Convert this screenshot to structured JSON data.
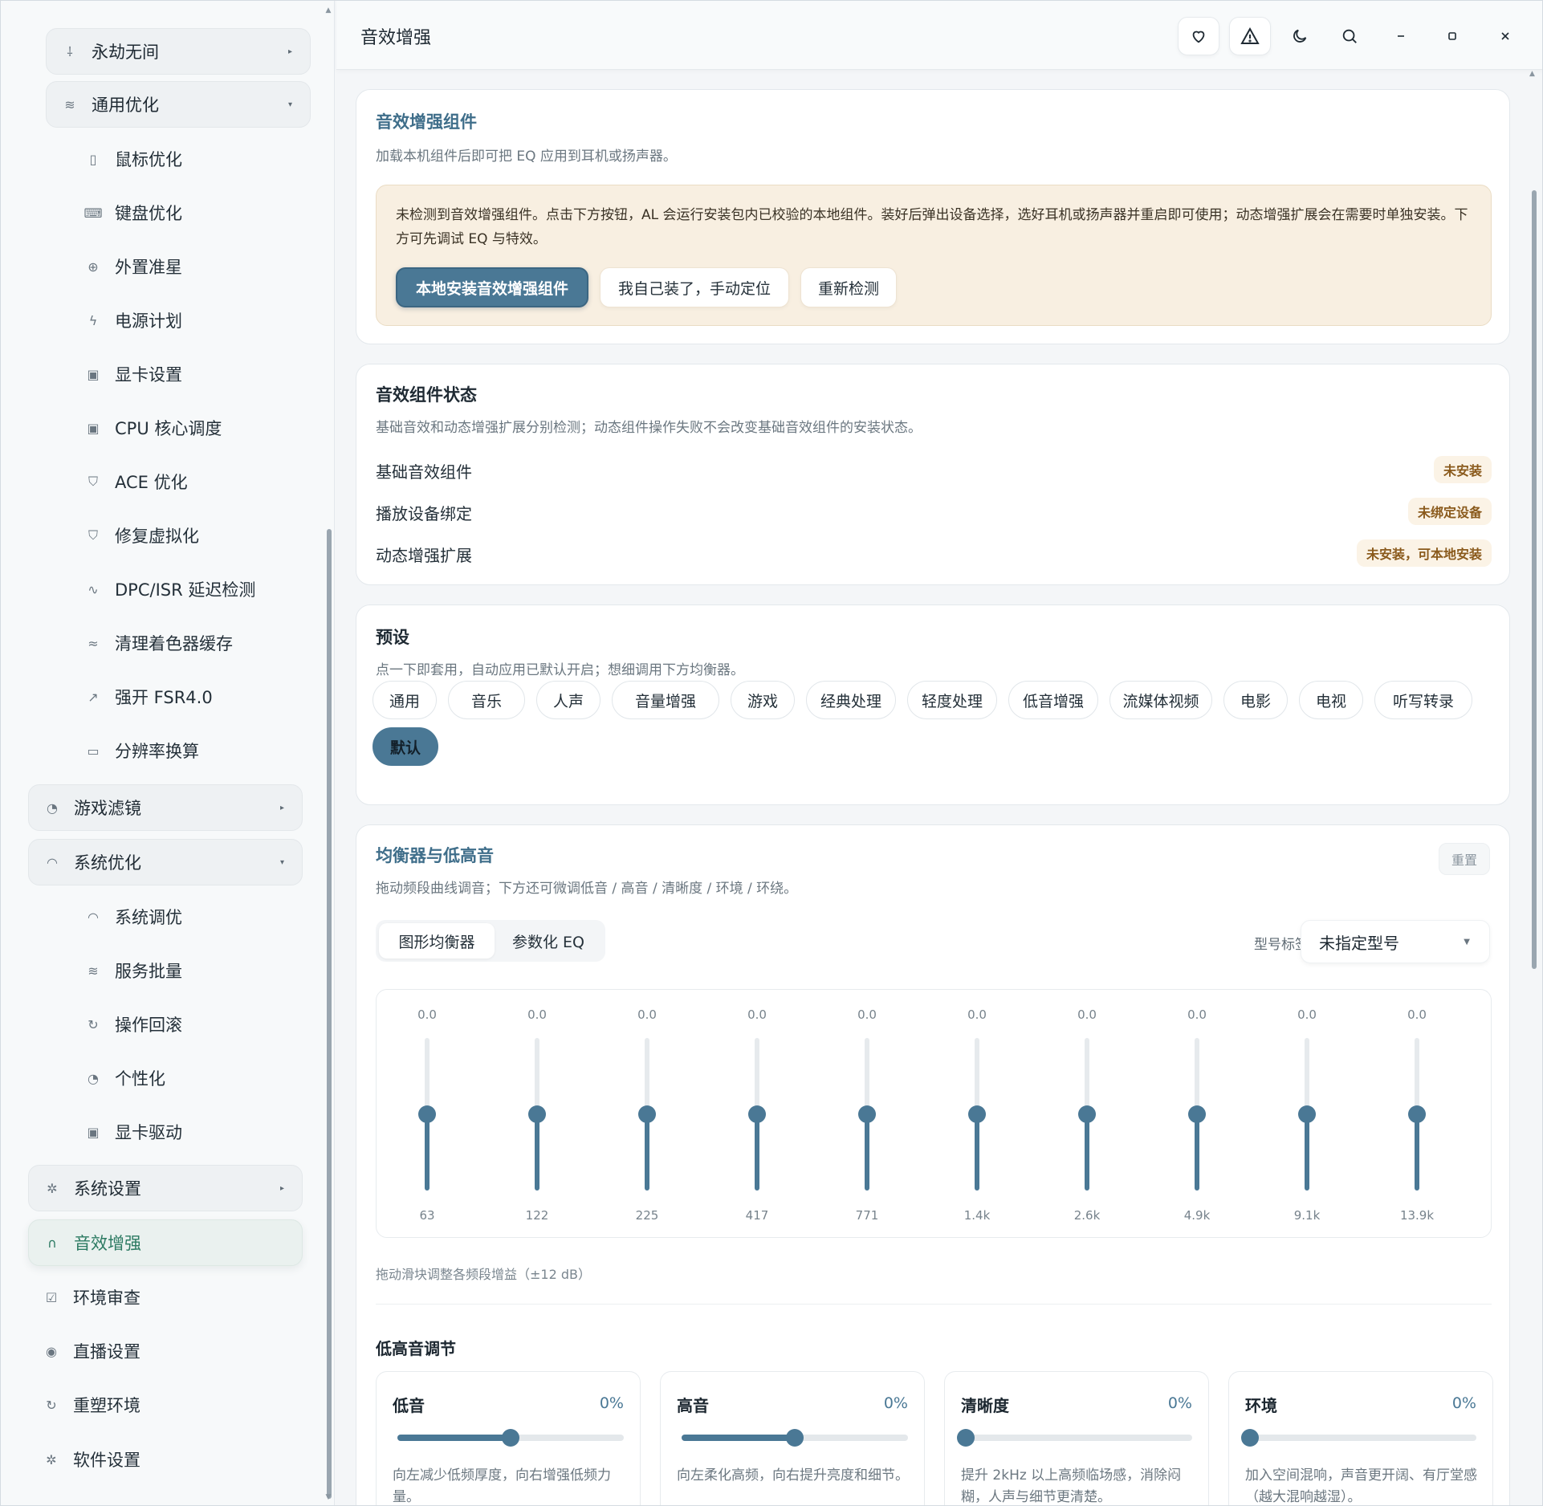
{
  "sidebar": {
    "items": [
      {
        "label": "永劫无间",
        "icon": "sword-icon",
        "caret": "▸"
      },
      {
        "label": "通用优化",
        "icon": "sliders-icon",
        "caret": "▾"
      },
      {
        "label": "鼠标优化",
        "icon": "mouse-icon"
      },
      {
        "label": "键盘优化",
        "icon": "keyboard-icon"
      },
      {
        "label": "外置准星",
        "icon": "crosshair-icon"
      },
      {
        "label": "电源计划",
        "icon": "bolt-icon"
      },
      {
        "label": "显卡设置",
        "icon": "chip-icon"
      },
      {
        "label": "CPU 核心调度",
        "icon": "chip-icon"
      },
      {
        "label": "ACE 优化",
        "icon": "shield-icon"
      },
      {
        "label": "修复虚拟化",
        "icon": "shield-icon"
      },
      {
        "label": "DPC/ISR 延迟检测",
        "icon": "pulse-icon"
      },
      {
        "label": "清理着色器缓存",
        "icon": "layers-icon"
      },
      {
        "label": "强开 FSR4.0",
        "icon": "expand-icon"
      },
      {
        "label": "分辨率换算",
        "icon": "monitor-icon"
      },
      {
        "label": "游戏滤镜",
        "icon": "palette-icon",
        "caret": "▸"
      },
      {
        "label": "系统优化",
        "icon": "gauge-icon",
        "caret": "▾"
      },
      {
        "label": "系统调优",
        "icon": "gauge-icon"
      },
      {
        "label": "服务批量",
        "icon": "sliders-icon"
      },
      {
        "label": "操作回滚",
        "icon": "refresh-icon"
      },
      {
        "label": "个性化",
        "icon": "palette-icon"
      },
      {
        "label": "显卡驱动",
        "icon": "chip-icon"
      },
      {
        "label": "系统设置",
        "icon": "gear-icon",
        "caret": "▸"
      },
      {
        "label": "音效增强",
        "icon": "headphones-icon"
      },
      {
        "label": "环境审查",
        "icon": "checkbox-icon"
      },
      {
        "label": "直播设置",
        "icon": "broadcast-icon"
      },
      {
        "label": "重塑环境",
        "icon": "refresh-icon"
      },
      {
        "label": "软件设置",
        "icon": "gear-icon"
      }
    ]
  },
  "header": {
    "title": "音效增强",
    "buttons": [
      "heart-icon",
      "warning-icon",
      "moon-icon",
      "search-icon",
      "minimize-icon",
      "maximize-icon",
      "close-icon"
    ]
  },
  "component": {
    "title": "音效增强组件",
    "subtitle": "加载本机组件后即可把 EQ 应用到耳机或扬声器。",
    "notice": "未检测到音效增强组件。点击下方按钮，AL 会运行安装包内已校验的本地组件。装好后弹出设备选择，选好耳机或扬声器并重启即可使用；动态增强扩展会在需要时单独安装。下方可先调试 EQ 与特效。",
    "install_label": "本地安装音效增强组件",
    "manual_label": "我自己装了，手动定位",
    "recheck_label": "重新检测"
  },
  "status": {
    "title": "音效组件状态",
    "subtitle": "基础音效和动态增强扩展分别检测；动态组件操作失败不会改变基础音效组件的安装状态。",
    "rows": [
      {
        "label": "基础音效组件",
        "badge": "未安装"
      },
      {
        "label": "播放设备绑定",
        "badge": "未绑定设备"
      },
      {
        "label": "动态增强扩展",
        "badge": "未安装，可本地安装"
      }
    ]
  },
  "presets": {
    "title": "预设",
    "subtitle": "点一下即套用，自动应用已默认开启；想细调用下方均衡器。",
    "items": [
      "通用",
      "音乐",
      "人声",
      "音量增强",
      "游戏",
      "经典处理",
      "轻度处理",
      "低音增强",
      "流媒体视频",
      "电影",
      "电视",
      "听写转录",
      "默认"
    ],
    "active": "默认"
  },
  "equalizer": {
    "title": "均衡器与低高音",
    "subtitle": "拖动频段曲线调音；下方还可微调低音 / 高音 / 清晰度 / 环境 / 环绕。",
    "reset_label": "重置",
    "tabs": [
      "图形均衡器",
      "参数化 EQ"
    ],
    "active_tab": "图形均衡器",
    "model_label": "型号标签",
    "model_value": "未指定型号",
    "bands": [
      {
        "freq": "63",
        "gain": "0.0"
      },
      {
        "freq": "122",
        "gain": "0.0"
      },
      {
        "freq": "225",
        "gain": "0.0"
      },
      {
        "freq": "417",
        "gain": "0.0"
      },
      {
        "freq": "771",
        "gain": "0.0"
      },
      {
        "freq": "1.4k",
        "gain": "0.0"
      },
      {
        "freq": "2.6k",
        "gain": "0.0"
      },
      {
        "freq": "4.9k",
        "gain": "0.0"
      },
      {
        "freq": "9.1k",
        "gain": "0.0"
      },
      {
        "freq": "13.9k",
        "gain": "0.0"
      }
    ],
    "gain_range_db": 12,
    "hint": "拖动滑块调整各频段增益（±12 dB）"
  },
  "tone": {
    "title": "低高音调节",
    "controls": [
      {
        "name": "低音",
        "value": "0%",
        "level": 0.5,
        "desc": "向左减少低频厚度，向右增强低频力量。"
      },
      {
        "name": "高音",
        "value": "0%",
        "level": 0.5,
        "desc": "向左柔化高频，向右提升亮度和细节。"
      },
      {
        "name": "清晰度",
        "value": "0%",
        "level": 0.0,
        "desc": "提升 2kHz 以上高频临场感，消除闷糊，人声与细节更清楚。"
      },
      {
        "name": "环境",
        "value": "0%",
        "level": 0.0,
        "desc": "加入空间混响，声音更开阔、有厅堂感（越大混响越湿）。"
      }
    ]
  },
  "colors": {
    "accent": "#4a7895",
    "active_nav": "#2c7a62",
    "badge_text": "#8a5a1c",
    "notice_bg": "#f8efe1"
  }
}
